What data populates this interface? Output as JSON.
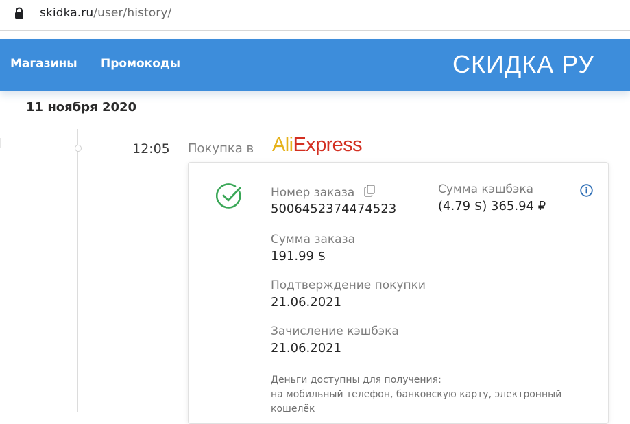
{
  "browser": {
    "url_domain": "skidka.ru",
    "url_path": "/user/history/"
  },
  "nav": {
    "links": [
      "Магазины",
      "Промокоды"
    ],
    "brand": "СКИДКА РУ"
  },
  "history": {
    "date": "11 ноября 2020",
    "time": "12:05",
    "purchase_label": "Покупка в",
    "store_logo": {
      "part1": "Ali",
      "part2": "Express",
      "color1": "#e6b21b",
      "color2": "#d32f21"
    },
    "order": {
      "number_label": "Номер заказа",
      "number_value": "5006452374474523",
      "amount_label": "Сумма заказа",
      "amount_value": "191.99 $",
      "confirm_label": "Подтверждение покупки",
      "confirm_value": "21.06.2021",
      "credit_label": "Зачисление кэшбэка",
      "credit_value": "21.06.2021",
      "cashback_label": "Сумма кэшбэка",
      "cashback_value": "(4.79 $) 365.94 ₽"
    },
    "note_line1": "Деньги доступны для получения:",
    "note_line2": "на мобильный телефон, банковскую карту, электронный",
    "note_line3": "кошелёк"
  },
  "colors": {
    "nav_bg": "#3d8ddb",
    "status_green": "#3aa757",
    "info_blue": "#2f6fb6"
  },
  "icons": [
    "lock-icon",
    "check-circle-icon",
    "copy-icon",
    "info-icon"
  ]
}
